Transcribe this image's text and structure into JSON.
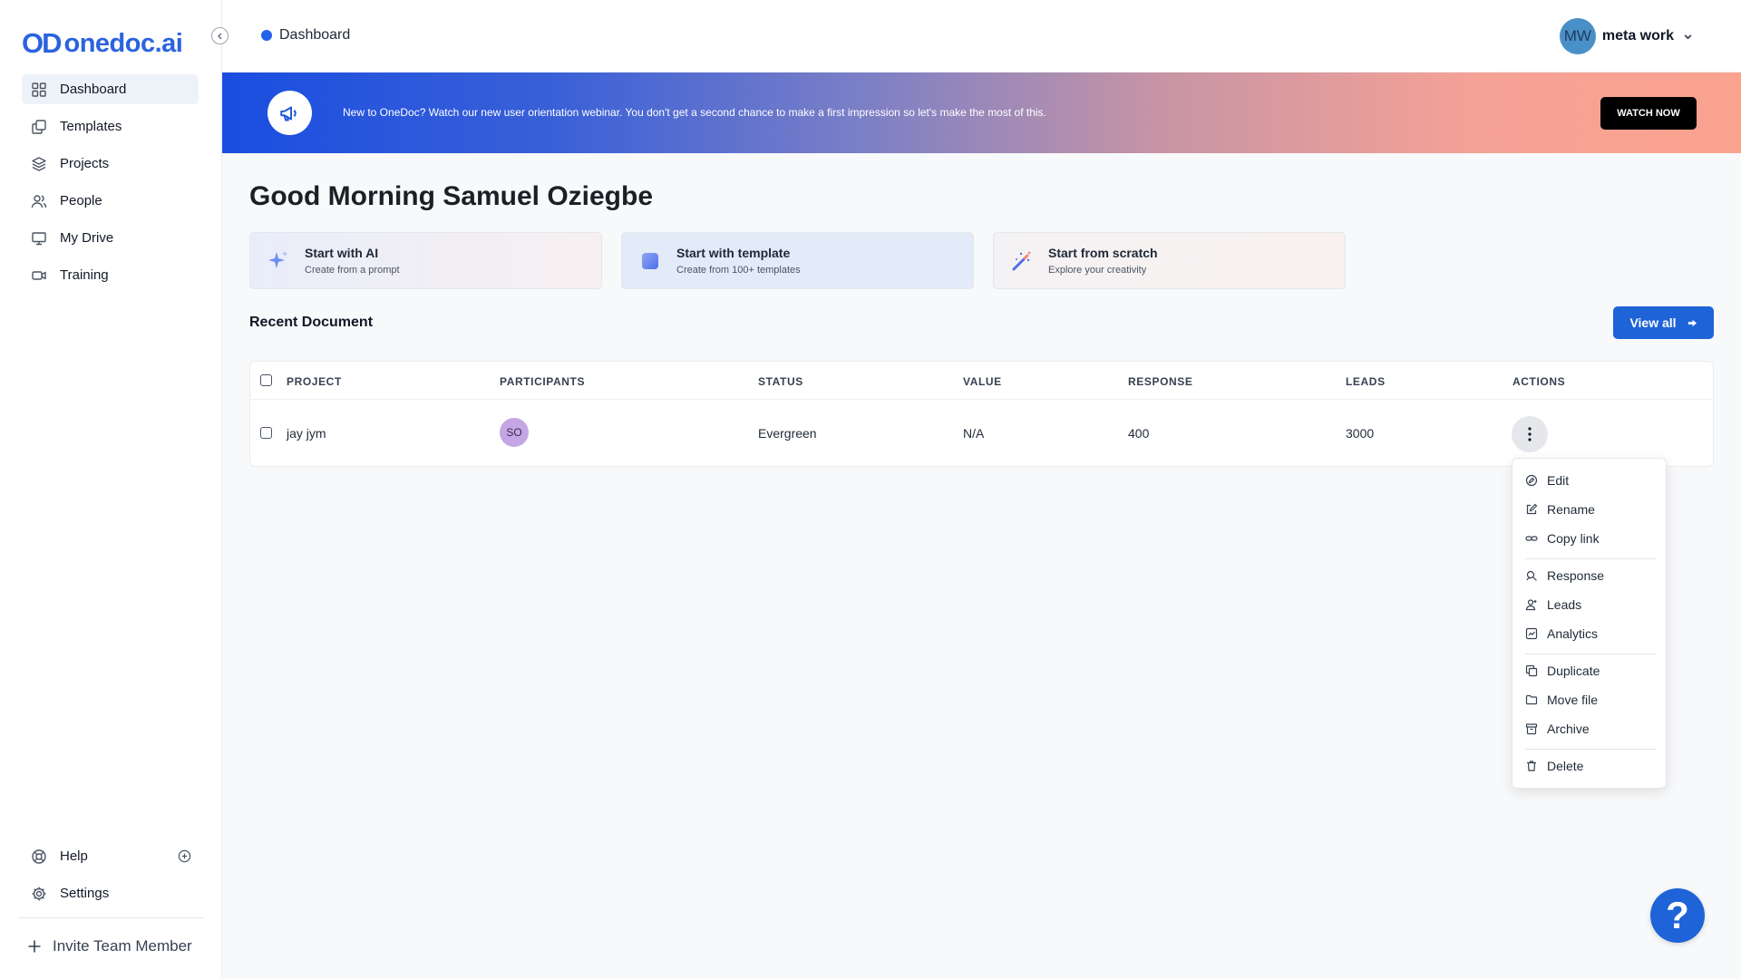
{
  "brand": {
    "mark": "OD",
    "name": "onedoc.ai",
    "color": "#2b63de"
  },
  "sidebar": {
    "items": [
      {
        "label": "Dashboard",
        "icon": "dashboard-grid-icon",
        "active": true
      },
      {
        "label": "Templates",
        "icon": "templates-icon"
      },
      {
        "label": "Projects",
        "icon": "layers-icon"
      },
      {
        "label": "People",
        "icon": "people-icon"
      },
      {
        "label": "My Drive",
        "icon": "monitor-icon"
      },
      {
        "label": "Training",
        "icon": "video-icon"
      }
    ],
    "bottom": [
      {
        "label": "Help",
        "icon": "lifebuoy-icon"
      },
      {
        "label": "Settings",
        "icon": "gear-icon"
      }
    ],
    "invite_label": "Invite Team Member"
  },
  "topbar": {
    "breadcrumb": "Dashboard",
    "user": {
      "initials": "MW",
      "name": "meta work"
    }
  },
  "banner": {
    "text": "New to OneDoc? Watch our new user orientation webinar. You don't get a second chance to make a first impression so let's make the most of this.",
    "button": "WATCH NOW"
  },
  "main": {
    "greeting": "Good Morning Samuel Oziegbe",
    "cards": [
      {
        "title": "Start with AI",
        "subtitle": "Create from a prompt"
      },
      {
        "title": "Start with template",
        "subtitle": "Create from 100+ templates"
      },
      {
        "title": "Start from scratch",
        "subtitle": "Explore your creativity"
      }
    ],
    "recent_title": "Recent Document",
    "view_all": "View all"
  },
  "table": {
    "headers": [
      "PROJECT",
      "PARTICIPANTS",
      "STATUS",
      "VALUE",
      "RESPONSE",
      "LEADS",
      "ACTIONS"
    ],
    "rows": [
      {
        "project": "jay jym",
        "participant_initials": "SO",
        "status": "Evergreen",
        "value": "N/A",
        "response": "400",
        "leads": "3000"
      }
    ]
  },
  "menu": {
    "items": [
      "Edit",
      "Rename",
      "Copy link",
      "Response",
      "Leads",
      "Analytics",
      "Duplicate",
      "Move file",
      "Archive",
      "Delete"
    ]
  },
  "help_fab": "?"
}
